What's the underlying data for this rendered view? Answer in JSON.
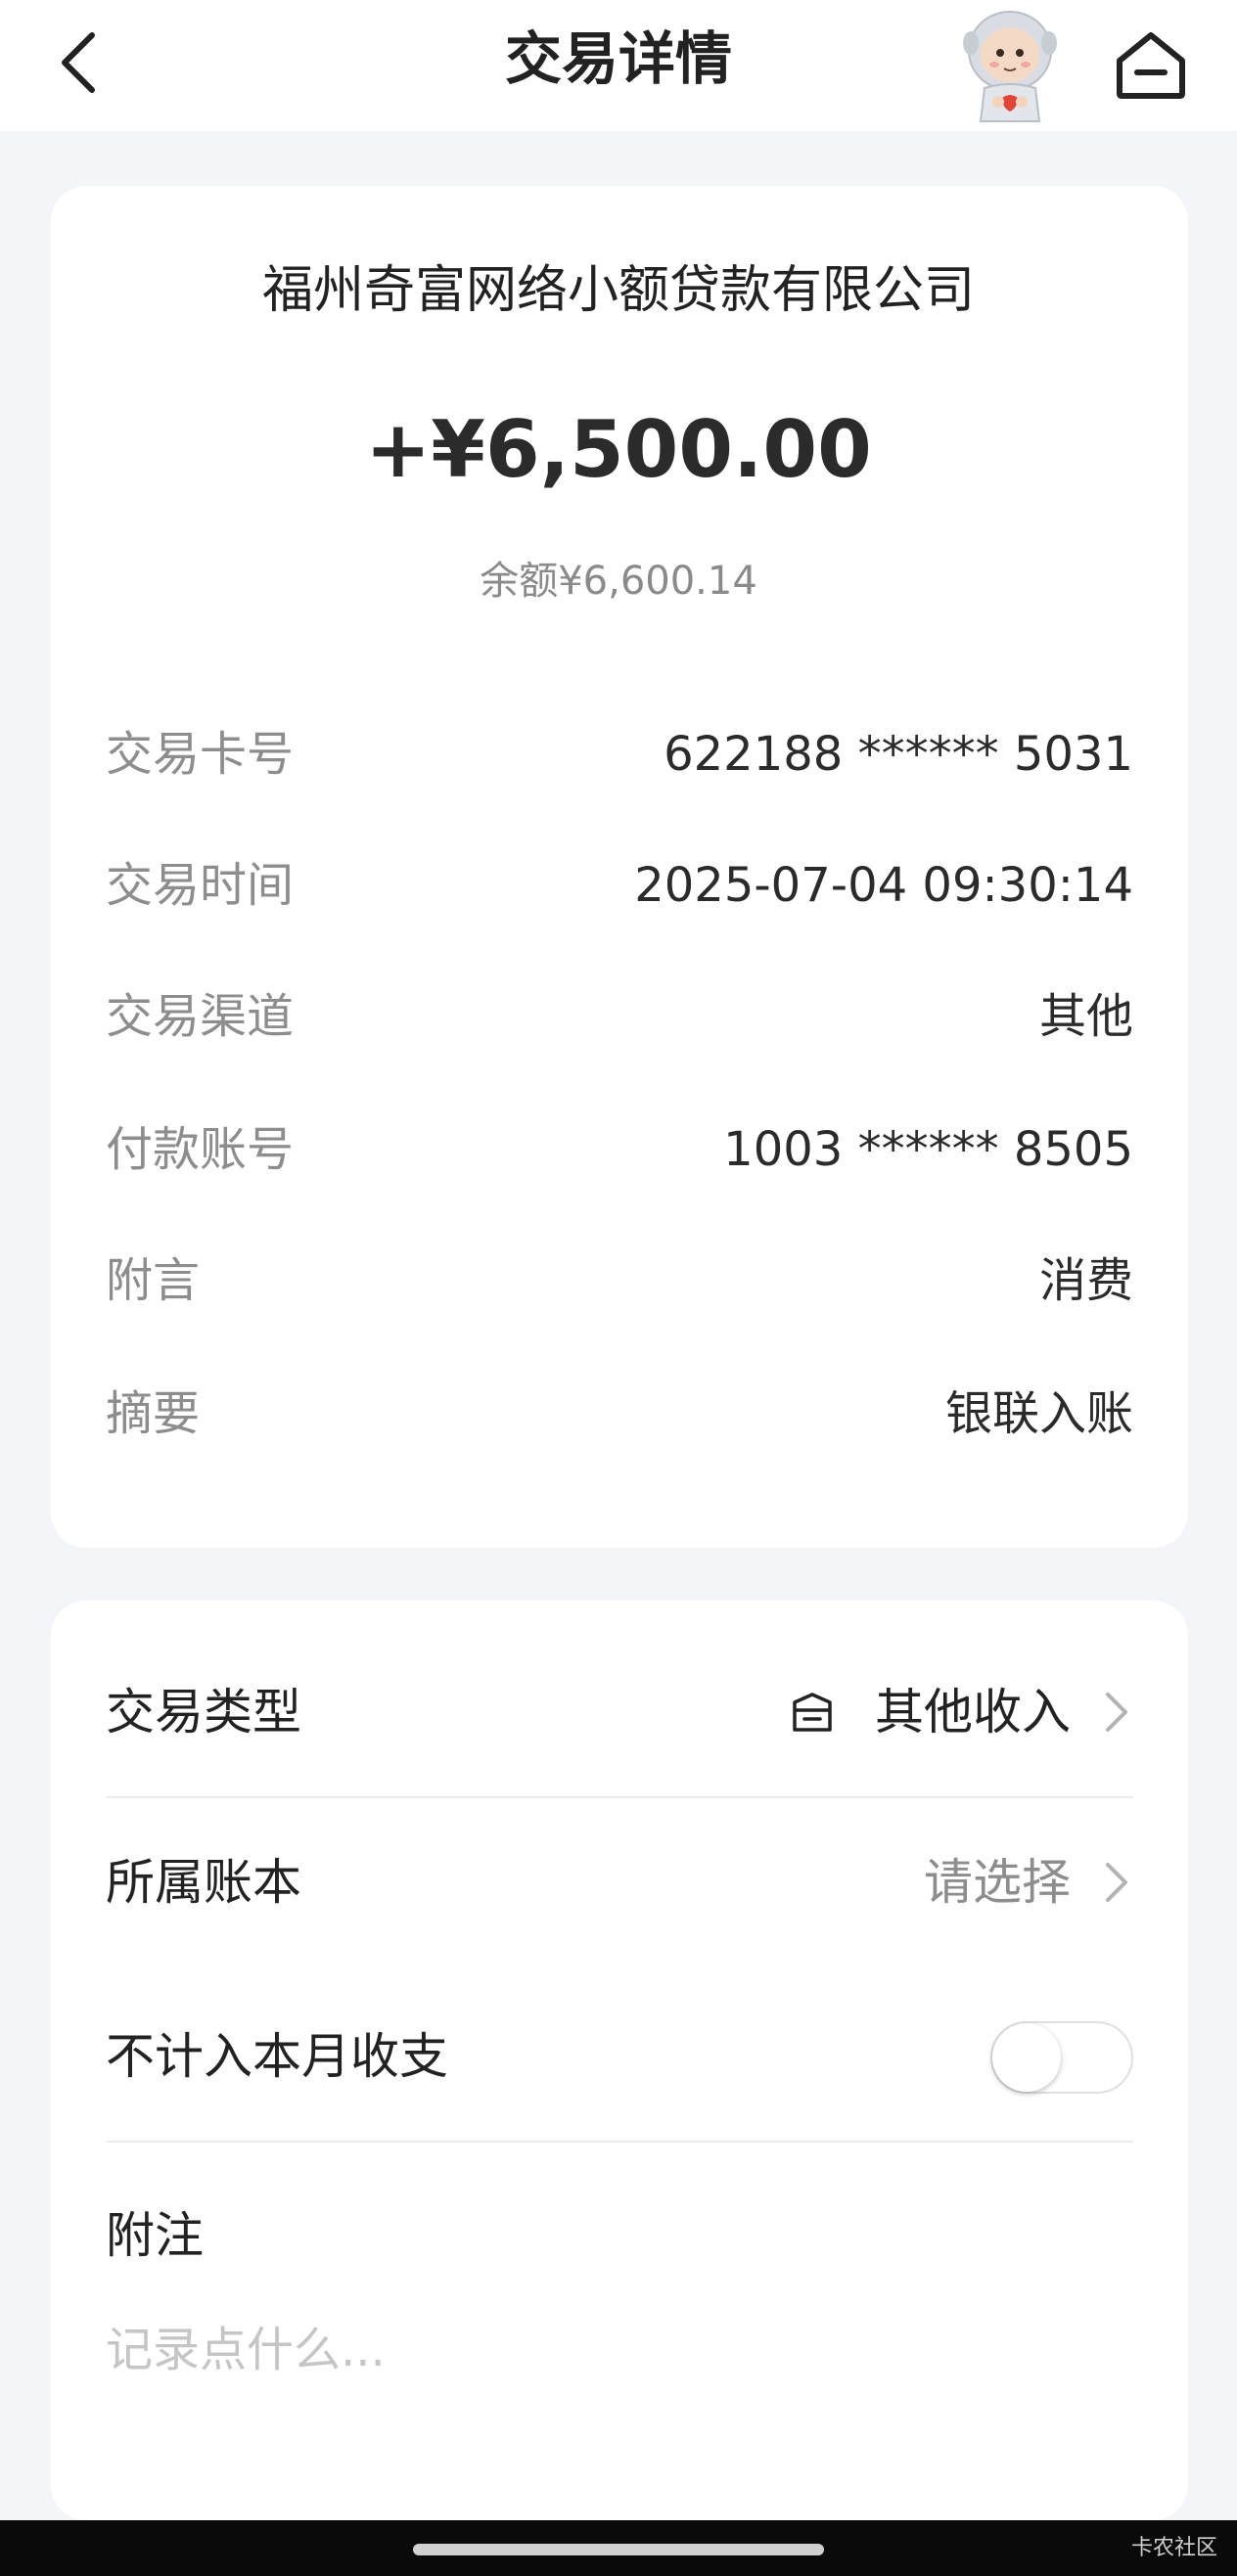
{
  "header": {
    "title": "交易详情",
    "icons": {
      "back": "chevron-left-icon",
      "home": "home-icon",
      "mascot": "mascot-avatar"
    }
  },
  "transaction": {
    "merchant": "福州奇富网络小额贷款有限公司",
    "amount": "+¥6,500.00",
    "balance": "余额¥6,600.14",
    "details": [
      {
        "label": "交易卡号",
        "value": "622188 ****** 5031"
      },
      {
        "label": "交易时间",
        "value": "2025-07-04 09:30:14"
      },
      {
        "label": "交易渠道",
        "value": "其他"
      },
      {
        "label": "付款账号",
        "value": "1003 ****** 8505"
      },
      {
        "label": "附言",
        "value": "消费"
      },
      {
        "label": "摘要",
        "value": "银联入账"
      }
    ]
  },
  "settings": {
    "type_label": "交易类型",
    "type_value": "其他收入",
    "book_label": "所属账本",
    "book_value": "请选择",
    "exclude_label": "不计入本月收支",
    "exclude_on": false,
    "note_label": "附注",
    "note_placeholder": "记录点什么...",
    "note_value": ""
  },
  "watermark": "卡农社区",
  "colors": {
    "background": "#f4f5f9",
    "card": "#ffffff",
    "label_gray": "#8d8d8d",
    "text": "#222222"
  }
}
